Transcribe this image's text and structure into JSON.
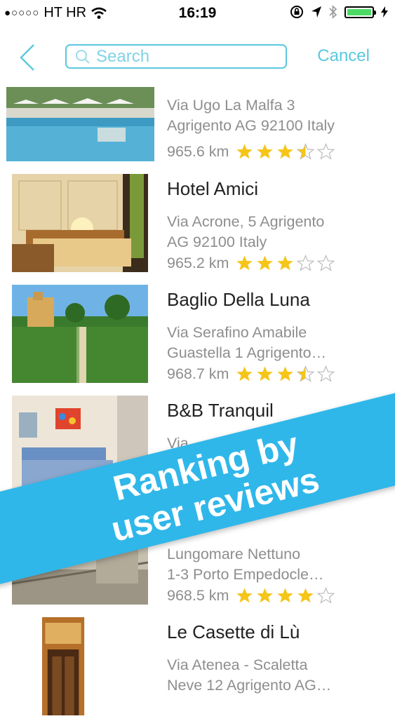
{
  "status_bar": {
    "carrier": "HT HR",
    "signal_dots": "●○○○○",
    "time": "16:19"
  },
  "search": {
    "placeholder": "Search",
    "value": "",
    "cancel_label": "Cancel"
  },
  "colors": {
    "accent": "#5ac8de",
    "banner": "#2fb7ea",
    "star": "#f5c518",
    "battery": "#4cd964"
  },
  "hotels": [
    {
      "name": "",
      "address": [
        "Via Ugo La Malfa 3",
        "Agrigento AG 92100 Italy"
      ],
      "distance": "965.6 km",
      "rating": 3.5
    },
    {
      "name": "Hotel Amici",
      "address": [
        "Via Acrone, 5 Agrigento",
        "AG 92100 Italy"
      ],
      "distance": "965.2 km",
      "rating": 3
    },
    {
      "name": "Baglio Della Luna",
      "address": [
        "Via Serafino Amabile",
        "Guastella 1 Agrigento…"
      ],
      "distance": "968.7 km",
      "rating": 3.5
    },
    {
      "name": "B&B Tranquil",
      "address": [
        "Via",
        ""
      ],
      "distance": "",
      "rating": null
    },
    {
      "name": "",
      "address": [
        "Lungomare Nettuno",
        "1-3 Porto Empedocle…"
      ],
      "distance": "968.5 km",
      "rating": 4
    },
    {
      "name": "Le Casette di Lù",
      "address": [
        "Via Atenea - Scaletta",
        "Neve 12 Agrigento AG…"
      ],
      "distance": "",
      "rating": null
    }
  ],
  "banner": {
    "line1": "Ranking by",
    "line2": "user reviews"
  }
}
